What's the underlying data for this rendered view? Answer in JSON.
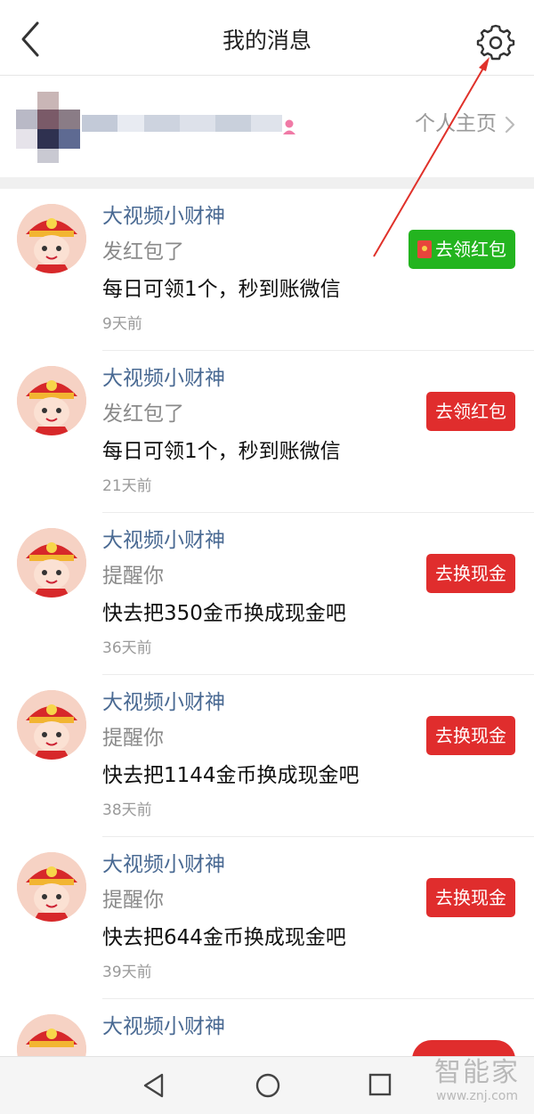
{
  "header": {
    "title": "我的消息",
    "back_icon": "chevron-left-icon",
    "settings_icon": "gear-icon"
  },
  "profile": {
    "link_label": "个人主页",
    "gender_icon": "female-icon",
    "chevron_icon": "chevron-right-icon"
  },
  "messages": [
    {
      "sender": "大视频小财神",
      "action": "发红包了",
      "content": "每日可领1个，秒到账微信",
      "time": "9天前",
      "button": "去领红包",
      "button_color": "#23b41f",
      "button_icon": "red-packet-icon"
    },
    {
      "sender": "大视频小财神",
      "action": "发红包了",
      "content": "每日可领1个，秒到账微信",
      "time": "21天前",
      "button": "去领红包",
      "button_color": "#e02d2d"
    },
    {
      "sender": "大视频小财神",
      "action": "提醒你",
      "content": "快去把350金币换成现金吧",
      "time": "36天前",
      "button": "去换现金",
      "button_color": "#e02d2d"
    },
    {
      "sender": "大视频小财神",
      "action": "提醒你",
      "content": "快去把1144金币换成现金吧",
      "time": "38天前",
      "button": "去换现金",
      "button_color": "#e02d2d"
    },
    {
      "sender": "大视频小财神",
      "action": "提醒你",
      "content": "快去把644金币换成现金吧",
      "time": "39天前",
      "button": "去换现金",
      "button_color": "#e02d2d"
    },
    {
      "sender": "大视频小财神"
    }
  ],
  "navbar": {
    "back_icon": "triangle-back-icon",
    "home_icon": "circle-home-icon",
    "recent_icon": "square-recent-icon"
  },
  "watermark": {
    "main": "智能家",
    "url": "www.znj.com"
  },
  "colors": {
    "accent_red": "#e02d2d",
    "accent_green": "#23b41f",
    "sender_blue": "#4a6a93",
    "annotation_arrow": "#e0312a"
  }
}
